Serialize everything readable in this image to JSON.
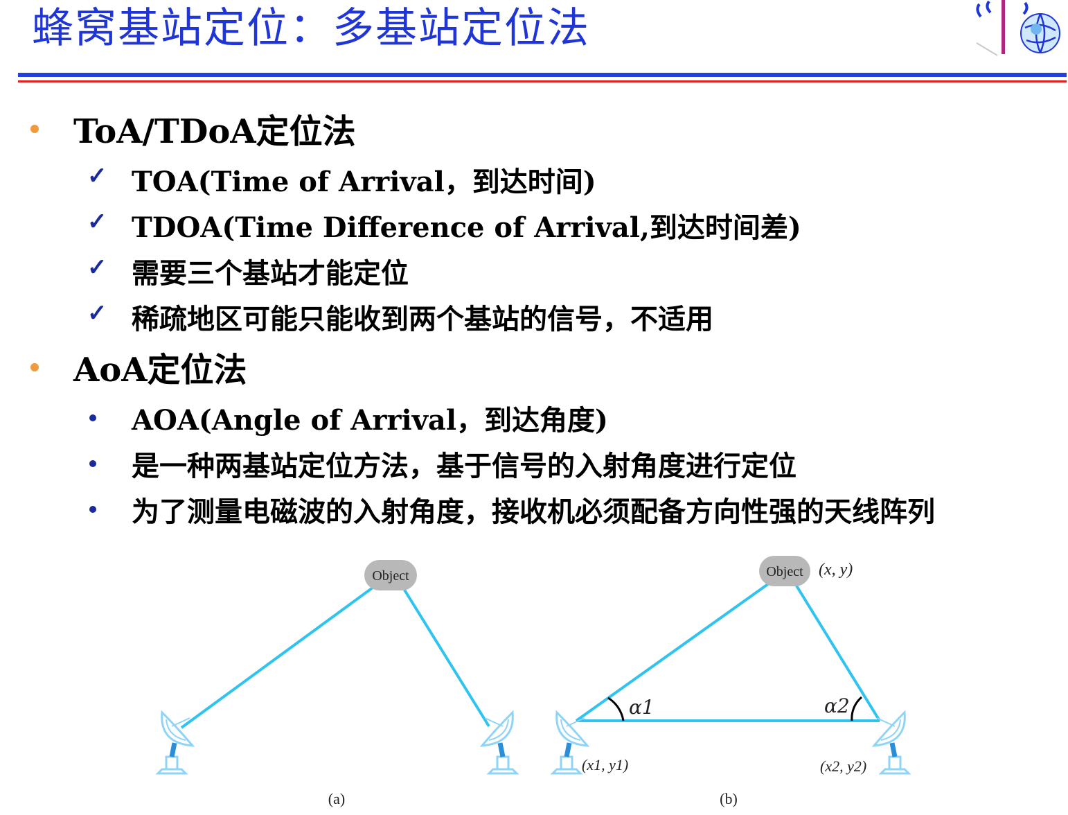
{
  "slide": {
    "title": "蜂窝基站定位：多基站定位法"
  },
  "bullets": {
    "toa_heading": "ToA/TDoA定位法",
    "toa_items": [
      "TOA(Time of Arrival，到达时间)",
      "TDOA(Time Difference of Arrival,到达时间差)",
      "需要三个基站才能定位",
      "稀疏地区可能只能收到两个基站的信号，不适用"
    ],
    "aoa_heading": "AoA定位法",
    "aoa_items": [
      "AOA(Angle of Arrival，到达角度)",
      "是一种两基站定位方法，基于信号的入射角度进行定位",
      "为了测量电磁波的入射角度，接收机必须配备方向性强的天线阵列"
    ]
  },
  "figure": {
    "panel_a": {
      "object_label": "Object",
      "caption": "(a)"
    },
    "panel_b": {
      "object_label": "Object",
      "object_coord": "(x, y)",
      "alpha1": "α1",
      "alpha2": "α2",
      "station1_coord": "(x1, y1)",
      "station2_coord": "(x2, y2)",
      "caption": "(b)"
    }
  },
  "colors": {
    "title": "#1f35d6",
    "line": "#2fc3f0",
    "dish": "#8fd4f6",
    "object_bubble": "#b8b8b8",
    "orange_bullet": "#f09a3c",
    "navy_marker": "#1a2a9a"
  }
}
